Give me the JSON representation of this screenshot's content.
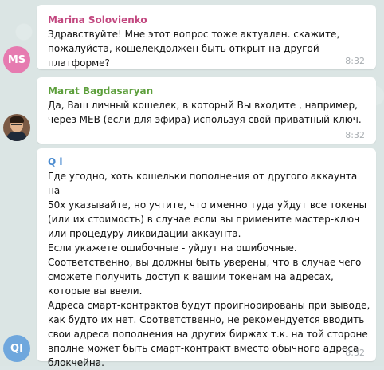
{
  "messages": [
    {
      "sender": "Marina Solovienko",
      "avatar_initials": "MS",
      "avatar_color": "#e67bb0",
      "name_color": "#c2477f",
      "text": "Здравствуйте! Мне этот вопрос тоже актуален. скажите,\nпожалуйста, кошелекдолжен быть открыт на другой платформе?",
      "time": "8:32"
    },
    {
      "sender": "Marat Bagdasaryan",
      "avatar_initials": "",
      "avatar_color": "#7b5a45",
      "name_color": "#5d9f3c",
      "text": "Да, Ваш личный кошелек, в который Вы входите , например,\nчерез МЕВ (если для эфира) используя свой приватный ключ.",
      "time": "8:32"
    },
    {
      "sender": "Q i",
      "avatar_initials": "QI",
      "avatar_color": "#6fa7dd",
      "name_color": "#4a8bd0",
      "text": "Где угодно, хоть кошельки пополнения от другого аккаунта на\n50х указывайте, но учтите, что именно туда уйдут все токены\n(или их стоимость) в случае если вы примените мастер-ключ\nили процедуру ликвидации аккаунта.\nЕсли укажете ошибочные - уйдут на ошибочные.\nСоответственно, вы должны быть уверены, что в случае чего\nсможете получить доступ к вашим токенам на адресах,\nкоторые вы ввели.\nАдреса смарт-контрактов будут проигнорированы при выводе,\nкак будто их нет. Соответственно, не рекомендуется вводить\nсвои адреса пополнения на других биржах т.к. на той стороне\nвполне может быть смарт-контракт вместо обычного адреса\nблокчейна.",
      "time": "8:32"
    }
  ]
}
